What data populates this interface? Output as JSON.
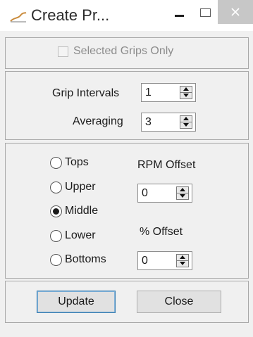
{
  "window": {
    "title": "Create Pr...",
    "icon": "chart-line-icon"
  },
  "selection": {
    "selected_grips_only_label": "Selected Grips Only",
    "selected_grips_only_checked": false,
    "selected_grips_only_enabled": false
  },
  "intervals": {
    "grip_intervals_label": "Grip Intervals",
    "grip_intervals_value": "1",
    "averaging_label": "Averaging",
    "averaging_value": "3"
  },
  "position": {
    "options": [
      {
        "label": "Tops",
        "checked": false
      },
      {
        "label": "Upper",
        "checked": false
      },
      {
        "label": "Middle",
        "checked": true
      },
      {
        "label": "Lower",
        "checked": false
      },
      {
        "label": "Bottoms",
        "checked": false
      }
    ],
    "rpm_offset_label": "RPM Offset",
    "rpm_offset_value": "0",
    "percent_offset_label": "% Offset",
    "percent_offset_value": "0"
  },
  "buttons": {
    "update_label": "Update",
    "close_label": "Close"
  },
  "colors": {
    "title_bar": "#ffffff",
    "close_button_bg": "#c7c7c7",
    "body_bg": "#f0f0f0",
    "default_button_border": "#3c7fb1"
  }
}
